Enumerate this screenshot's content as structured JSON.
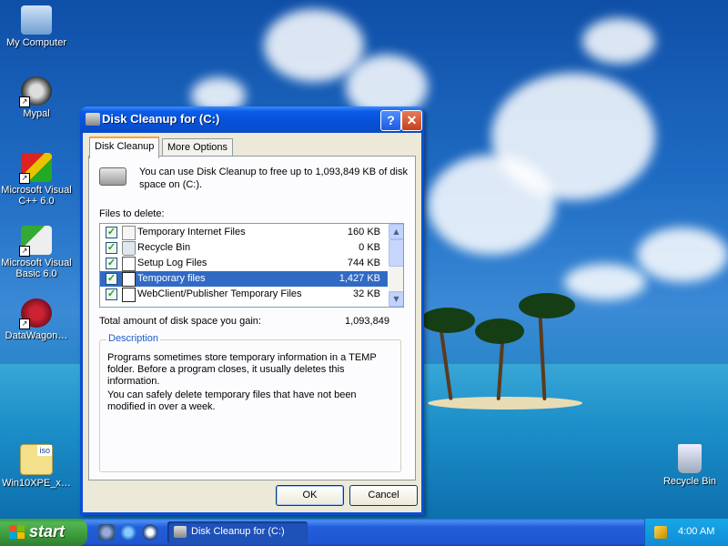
{
  "desktop": {
    "icons": [
      {
        "label": "My Computer"
      },
      {
        "label": "Mypal"
      },
      {
        "label": "Microsoft Visual C++ 6.0"
      },
      {
        "label": "Microsoft Visual Basic 6.0"
      },
      {
        "label": "DataWagon…"
      },
      {
        "label": "Win10XPE_x…"
      },
      {
        "label": "Recycle Bin"
      }
    ],
    "iso_badge": "iso"
  },
  "window": {
    "title": "Disk Cleanup for  (C:)",
    "help_glyph": "?",
    "close_glyph": "✕",
    "tabs": [
      {
        "label": "Disk Cleanup",
        "active": true
      },
      {
        "label": "More Options",
        "active": false
      }
    ],
    "intro_text": "You can use Disk Cleanup to free up to 1,093,849 KB of disk space on  (C:).",
    "files_label": "Files to delete:",
    "files": [
      {
        "name": "Temporary Internet Files",
        "size": "160 KB",
        "checked": true,
        "selected": false,
        "icon": "internet-files-icon"
      },
      {
        "name": "Recycle Bin",
        "size": "0 KB",
        "checked": true,
        "selected": false,
        "icon": "recycle-bin-icon"
      },
      {
        "name": "Setup Log Files",
        "size": "744 KB",
        "checked": true,
        "selected": false,
        "icon": "log-file-icon"
      },
      {
        "name": "Temporary files",
        "size": "1,427 KB",
        "checked": true,
        "selected": true,
        "icon": "temp-files-icon"
      },
      {
        "name": "WebClient/Publisher Temporary Files",
        "size": "32 KB",
        "checked": true,
        "selected": false,
        "icon": "webclient-files-icon"
      }
    ],
    "total_label": "Total amount of disk space you gain:",
    "total_value": "1,093,849",
    "description": {
      "title": "Description",
      "paragraph1": "Programs sometimes store temporary information in a TEMP folder. Before a program closes, it usually deletes this information.",
      "paragraph2": "You can safely delete temporary files that have not been modified in over a week."
    },
    "ok_label": "OK",
    "cancel_label": "Cancel"
  },
  "taskbar": {
    "start_label": "start",
    "task_label": "Disk Cleanup for  (C:)",
    "clock": "4:00 AM"
  },
  "colors": {
    "selection": "#316ac5",
    "titlebar": "#0a5ce6",
    "start_green": "#389438",
    "tab_highlight": "#f7a431",
    "group_title": "#1d5cc7"
  }
}
